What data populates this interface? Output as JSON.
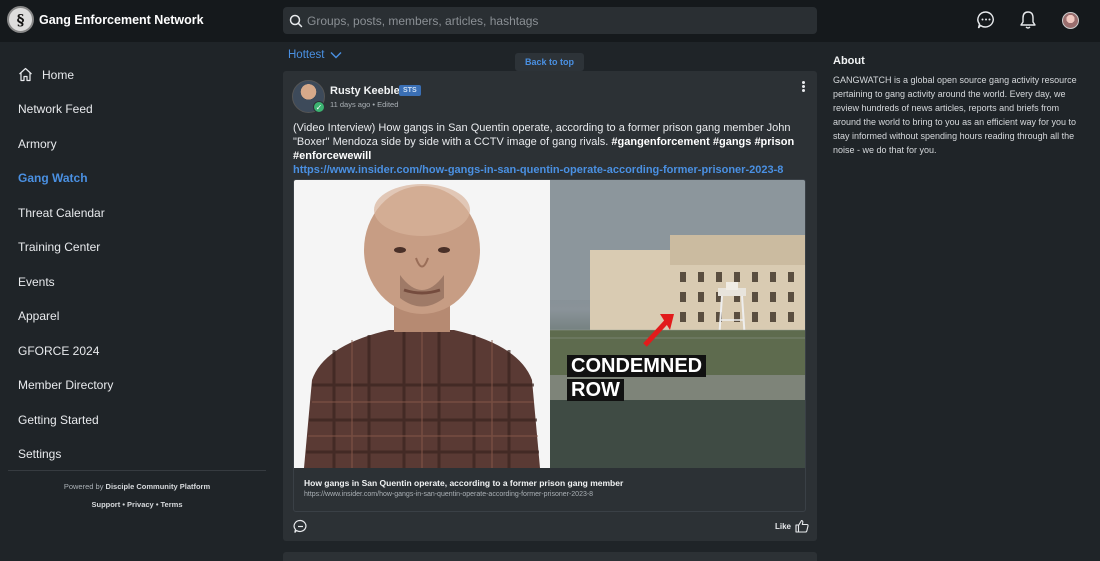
{
  "app": {
    "name": "Gang Enforcement Network",
    "logo_glyph": "§"
  },
  "search": {
    "placeholder": "Groups, posts, members, articles, hashtags"
  },
  "top_icons": [
    "chat-icon",
    "bell-icon",
    "profile-avatar"
  ],
  "sidebar": {
    "items": [
      {
        "label": "Home",
        "icon": "home-icon",
        "active": false
      },
      {
        "label": "Network Feed",
        "active": false
      },
      {
        "label": "Armory",
        "active": false
      },
      {
        "label": "Gang Watch",
        "active": true
      },
      {
        "label": "Threat Calendar",
        "active": false
      },
      {
        "label": "Training Center",
        "active": false
      },
      {
        "label": "Events",
        "active": false
      },
      {
        "label": "Apparel",
        "active": false
      },
      {
        "label": "GFORCE 2024",
        "active": false
      },
      {
        "label": "Member Directory",
        "active": false
      },
      {
        "label": "Getting Started",
        "active": false
      },
      {
        "label": "Settings",
        "active": false
      }
    ],
    "powered_prefix": "Powered by ",
    "powered_name": "Disciple Community Platform",
    "links": [
      "Support",
      "Privacy",
      "Terms"
    ],
    "links_separator": " • "
  },
  "feed": {
    "sort_label": "Hottest",
    "back_to_top": "Back to top"
  },
  "post": {
    "author": "Rusty Keeble",
    "badge": "STS",
    "time": "11 days ago",
    "edited": "Edited",
    "meta_separator": " • ",
    "text": "(Video Interview) How gangs in San Quentin operate, according to a former prison gang member John \"Boxer\" Mendoza side by side with a CCTV image of gang rivals. ",
    "hashtags": "#gangenforcement #gangs #prison #enforcewewill",
    "link": "https://www.insider.com/how-gangs-in-san-quentin-operate-according-former-prisoner-2023-8",
    "preview": {
      "overlay_line1": "CONDEMNED",
      "overlay_line2": "ROW",
      "title": "How gangs in San Quentin operate, according to a former prison gang member",
      "url": "https://www.insider.com/how-gangs-in-san-quentin-operate-according-former-prisoner-2023-8"
    },
    "like_label": "Like"
  },
  "about": {
    "heading": "About",
    "body": "GANGWATCH is a global open source gang activity resource pertaining to gang activity around the world. Every day, we review hundreds of news articles, reports and briefs from around the world to bring to you as an efficient way for you to stay informed without spending hours reading through all the noise - we do that for you."
  },
  "colors": {
    "accent": "#4a90e2",
    "background": "#1f2428",
    "topbar": "#15191c",
    "card": "#2c3135"
  }
}
